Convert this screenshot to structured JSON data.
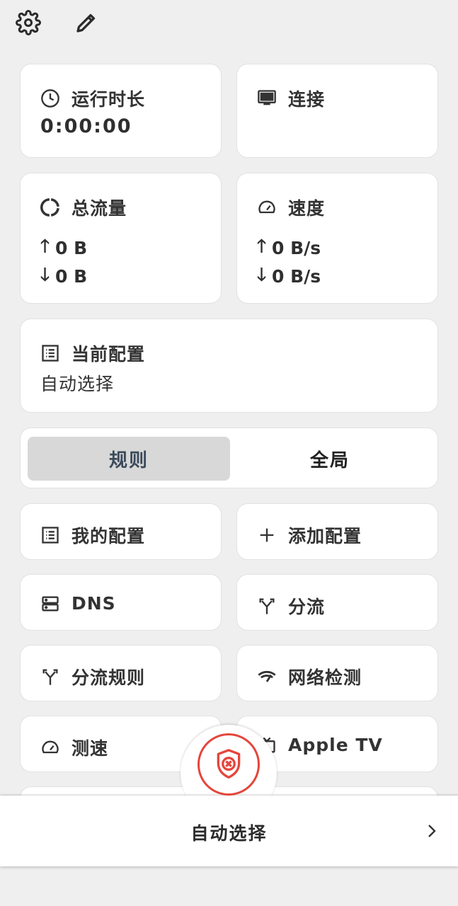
{
  "header": {
    "settings_icon": "gear-icon",
    "edit_icon": "pencil-icon"
  },
  "runtime": {
    "title": "运行时长",
    "value": "0:00:00",
    "icon": "clock-icon"
  },
  "connection": {
    "title": "连接",
    "icon": "monitor-icon"
  },
  "traffic": {
    "title": "总流量",
    "up": "0 B",
    "down": "0 B",
    "icon": "donut-icon"
  },
  "speed": {
    "title": "速度",
    "up": "0 B/s",
    "down": "0 B/s",
    "icon": "speedometer-icon"
  },
  "profile": {
    "title": "当前配置",
    "value": "自动选择",
    "icon": "list-icon"
  },
  "mode": {
    "rule": "规则",
    "global": "全局",
    "selected": "rule"
  },
  "tiles": {
    "my_profiles": "我的配置",
    "add_profile": "添加配置",
    "dns": "DNS",
    "split": "分流",
    "split_rules": "分流规则",
    "network_check": "网络检测",
    "speed_test": "测速",
    "apple_tv": "Apple TV"
  },
  "bottom": {
    "label": "自动选择",
    "status_icon": "shield-x-icon",
    "accent": "#e5453b"
  }
}
